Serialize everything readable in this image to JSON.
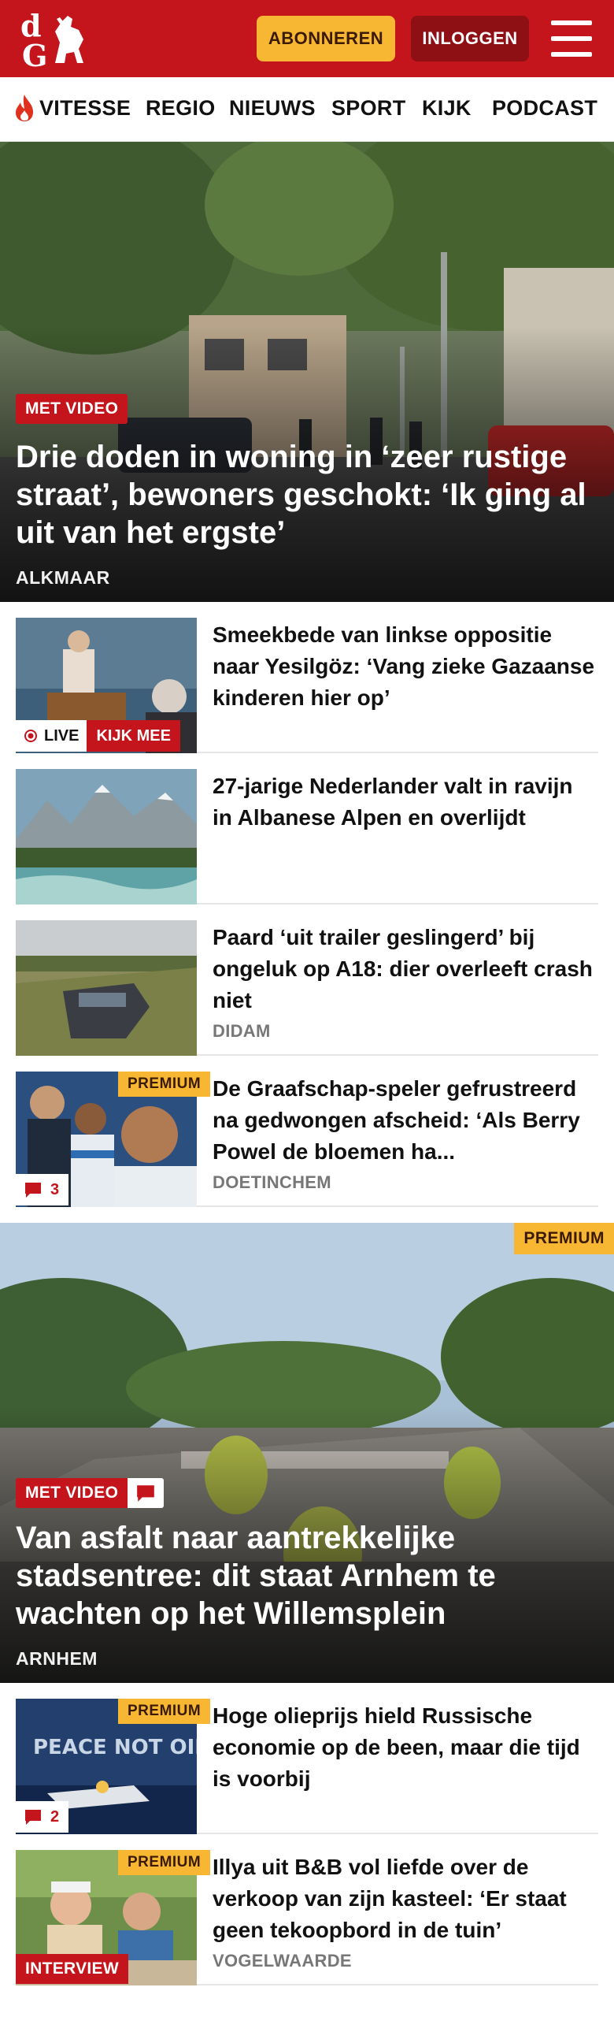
{
  "header": {
    "logo_text": "dG",
    "subscribe_label": "ABONNEREN",
    "login_label": "INLOGGEN",
    "brand_color": "#c4151c",
    "accent_color": "#f7b733",
    "icons": {
      "menu": "hamburger-icon"
    }
  },
  "nav": {
    "items": [
      "VITESSE",
      "REGIO",
      "NIEUWS",
      "SPORT",
      "KIJK",
      "PODCAST"
    ],
    "icons": {
      "first_item": "flame-icon"
    }
  },
  "hero": {
    "badge": "MET VIDEO",
    "title": "Drie doden in woning in ‘zeer rustige straat’, bewoners geschokt: ‘Ik ging al uit van het ergste’",
    "location": "ALKMAAR"
  },
  "articles": [
    {
      "title": "Smeekbede van linkse oppositie naar Yesilgöz: ‘Vang zieke Gazaanse kinderen hier op’",
      "location": "",
      "live_label": "LIVE",
      "watch_label": "KIJK MEE"
    },
    {
      "title": "27-jarige Nederlander valt in ravijn in Albanese Alpen en overlijdt",
      "location": ""
    },
    {
      "title": "Paard ‘uit trailer geslingerd’ bij ongeluk op A18: dier overleeft crash niet",
      "location": "DIDAM"
    },
    {
      "title": "De Graafschap-speler gefrus­treerd na gedwongen afscheid: ‘Als Berry Powel de bloemen ha...",
      "location": "DOETINCHEM",
      "premium": "PREMIUM",
      "comments": "3"
    }
  ],
  "hero2": {
    "premium": "PREMIUM",
    "badge": "MET VIDEO",
    "title": "Van asfalt naar aantrekkelijke stadsentree: dit staat Arnhem te wachten op het Willemsplein",
    "location": "ARNHEM"
  },
  "articles2": [
    {
      "title": "Hoge olieprijs hield Russische economie op de been, maar die tijd is voorbij",
      "location": "",
      "premium": "PREMIUM",
      "comments": "2"
    },
    {
      "title": "Illya uit B&B vol liefde over de verkoop van zijn kasteel: ‘Er staat geen tekoopbord in de tuin’",
      "location": "VOGELWAARDE",
      "premium": "PREMIUM",
      "tag": "INTERVIEW"
    }
  ]
}
